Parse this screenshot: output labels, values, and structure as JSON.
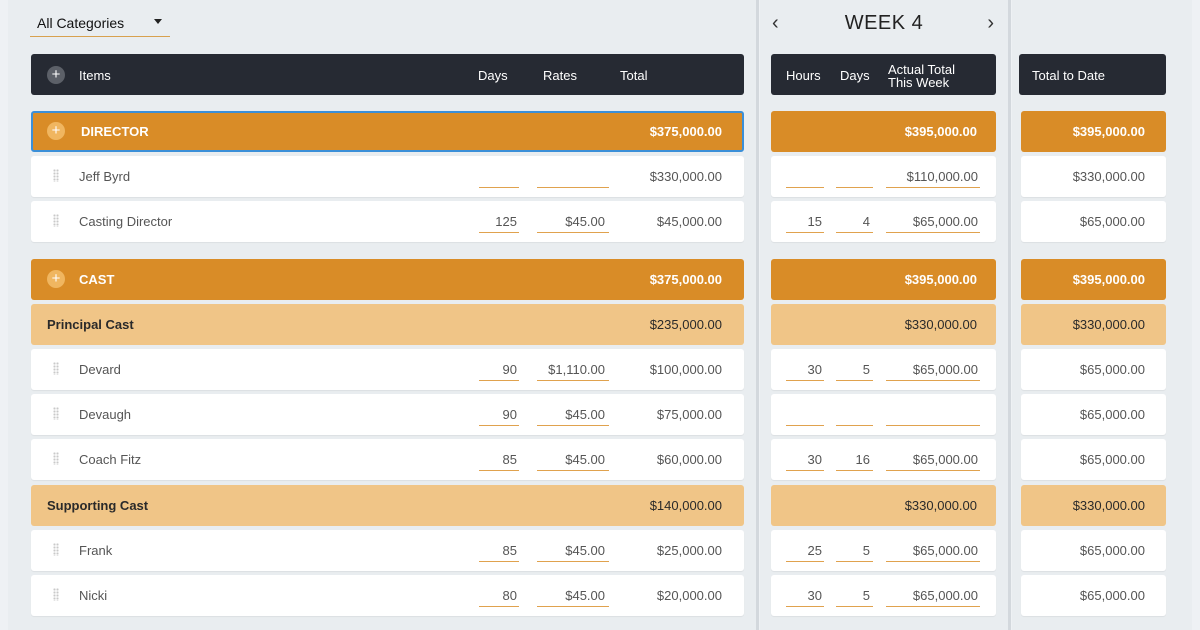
{
  "filter": {
    "selected": "All Categories"
  },
  "week_nav": {
    "label": "WEEK 4",
    "prev": "‹",
    "next": "›"
  },
  "headers": {
    "items": "Items",
    "days": "Days",
    "rates": "Rates",
    "total": "Total",
    "hours": "Hours",
    "week_days": "Days",
    "actual_total_line1": "Actual Total",
    "actual_total_line2": "This Week",
    "total_to_date": "Total to Date"
  },
  "rows": [
    {
      "kind": "category",
      "label": "DIRECTOR",
      "total": "$375,000.00",
      "week_total": "$395,000.00",
      "to_date": "$395,000.00"
    },
    {
      "kind": "item",
      "label": "Jeff Byrd",
      "days": "",
      "rate": "",
      "total": "$330,000.00",
      "hours": "",
      "week_days": "",
      "week_total": "$110,000.00",
      "to_date": "$330,000.00"
    },
    {
      "kind": "item",
      "label": "Casting Director",
      "days": "125",
      "rate": "$45.00",
      "total": "$45,000.00",
      "hours": "15",
      "week_days": "4",
      "week_total": "$65,000.00",
      "to_date": "$65,000.00"
    },
    {
      "kind": "category",
      "label": "CAST",
      "total": "$375,000.00",
      "week_total": "$395,000.00",
      "to_date": "$395,000.00"
    },
    {
      "kind": "subcategory",
      "label": "Principal Cast",
      "total": "$235,000.00",
      "week_total": "$330,000.00",
      "to_date": "$330,000.00"
    },
    {
      "kind": "item",
      "label": "Devard",
      "days": "90",
      "rate": "$1,110.00",
      "total": "$100,000.00",
      "hours": "30",
      "week_days": "5",
      "week_total": "$65,000.00",
      "to_date": "$65,000.00"
    },
    {
      "kind": "item",
      "label": "Devaugh",
      "days": "90",
      "rate": "$45.00",
      "total": "$75,000.00",
      "hours": "",
      "week_days": "",
      "week_total": "",
      "to_date": "$65,000.00"
    },
    {
      "kind": "item",
      "label": "Coach Fitz",
      "days": "85",
      "rate": "$45.00",
      "total": "$60,000.00",
      "hours": "30",
      "week_days": "16",
      "week_total": "$65,000.00",
      "to_date": "$65,000.00"
    },
    {
      "kind": "subcategory",
      "label": "Supporting Cast",
      "total": "$140,000.00",
      "week_total": "$330,000.00",
      "to_date": "$330,000.00"
    },
    {
      "kind": "item",
      "label": "Frank",
      "days": "85",
      "rate": "$45.00",
      "total": "$25,000.00",
      "hours": "25",
      "week_days": "5",
      "week_total": "$65,000.00",
      "to_date": "$65,000.00"
    },
    {
      "kind": "item",
      "label": "Nicki",
      "days": "80",
      "rate": "$45.00",
      "total": "$20,000.00",
      "hours": "30",
      "week_days": "5",
      "week_total": "$65,000.00",
      "to_date": "$65,000.00"
    }
  ],
  "colors": {
    "category": "#d98c27",
    "subcategory": "#f0c587",
    "header": "#262a33",
    "selection": "#3b8fd8"
  }
}
